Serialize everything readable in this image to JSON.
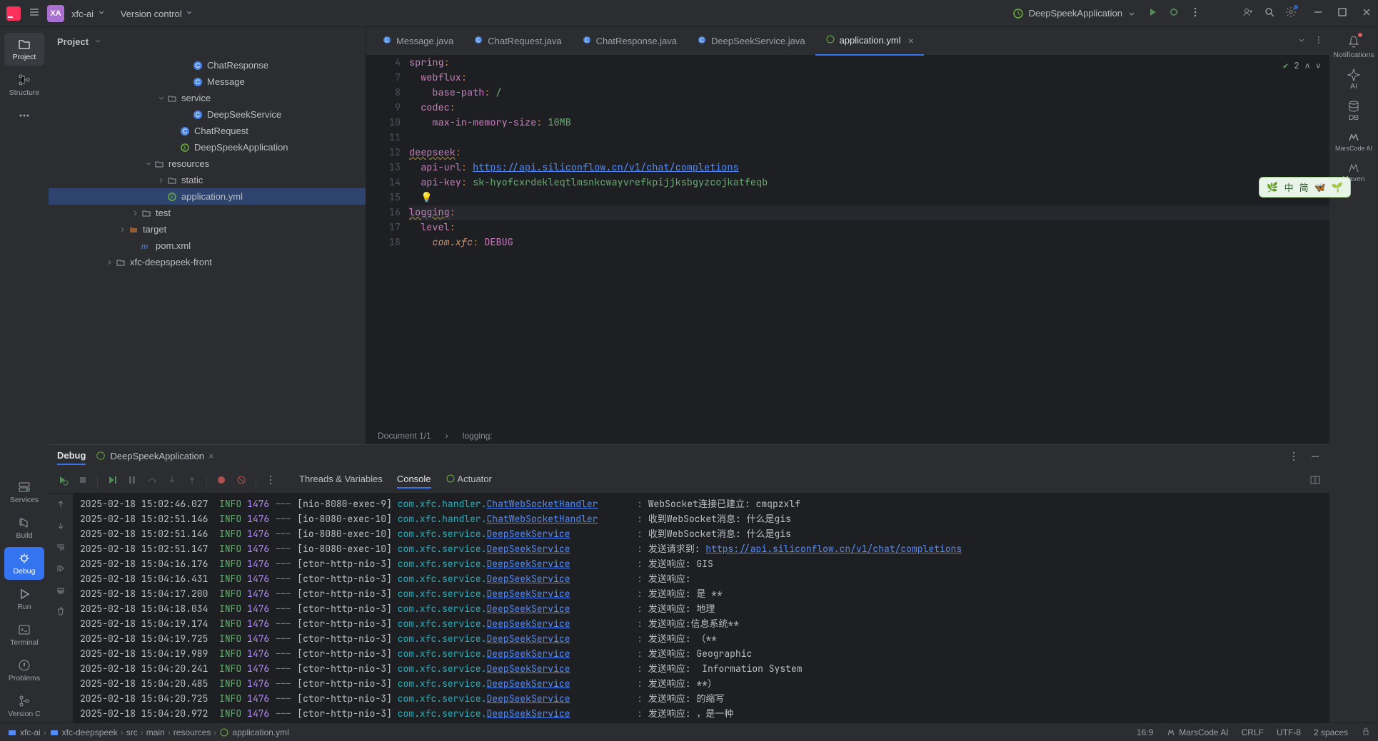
{
  "titlebar": {
    "project_avatar": "XA",
    "project_name": "xfc-ai",
    "version_control": "Version control",
    "run_config": "DeepSpeekApplication"
  },
  "left_tools": [
    {
      "id": "project",
      "label": "Project"
    },
    {
      "id": "structure",
      "label": "Structure"
    },
    {
      "id": "more",
      "label": "..."
    },
    {
      "id": "services",
      "label": "Services"
    },
    {
      "id": "build",
      "label": "Build"
    },
    {
      "id": "debug",
      "label": "Debug"
    },
    {
      "id": "run",
      "label": "Run"
    },
    {
      "id": "terminal",
      "label": "Terminal"
    },
    {
      "id": "problems",
      "label": "Problems"
    },
    {
      "id": "versionc",
      "label": "Version C"
    }
  ],
  "project_header": "Project",
  "tree": [
    {
      "indent": 7,
      "type": "class",
      "label": "ChatResponse"
    },
    {
      "indent": 7,
      "type": "class",
      "label": "Message"
    },
    {
      "indent": 5,
      "type": "pkg",
      "label": "service",
      "expanded": true
    },
    {
      "indent": 7,
      "type": "class",
      "label": "DeepSeekService"
    },
    {
      "indent": 6,
      "type": "class",
      "label": "ChatRequest"
    },
    {
      "indent": 6,
      "type": "spring",
      "label": "DeepSpeekApplication"
    },
    {
      "indent": 4,
      "type": "folder",
      "label": "resources",
      "expanded": true
    },
    {
      "indent": 5,
      "type": "folder",
      "label": "static",
      "collapsed": true
    },
    {
      "indent": 5,
      "type": "spring",
      "label": "application.yml",
      "selected": true
    },
    {
      "indent": 3,
      "type": "folder",
      "label": "test",
      "collapsed": true
    },
    {
      "indent": 2,
      "type": "target",
      "label": "target",
      "collapsed": true
    },
    {
      "indent": 3,
      "type": "maven",
      "label": "pom.xml"
    },
    {
      "indent": 1,
      "type": "folder",
      "label": "xfc-deepspeek-front",
      "collapsed": true
    }
  ],
  "editor_tabs": [
    {
      "label": "Message.java",
      "icon": "class"
    },
    {
      "label": "ChatRequest.java",
      "icon": "class"
    },
    {
      "label": "ChatResponse.java",
      "icon": "class"
    },
    {
      "label": "DeepSeekService.java",
      "icon": "class"
    },
    {
      "label": "application.yml",
      "icon": "spring",
      "active": true,
      "closable": true
    }
  ],
  "inspection": {
    "warnings": "2"
  },
  "code": [
    {
      "n": 4,
      "t": "spring",
      "rest": ":"
    },
    {
      "n": 7,
      "t": "  webflux",
      "rest": ":"
    },
    {
      "n": 8,
      "t": "    base-path",
      "rest": ": ",
      "val": "/"
    },
    {
      "n": 9,
      "t": "  codec",
      "rest": ":"
    },
    {
      "n": 10,
      "t": "    max-in-memory-size",
      "rest": ": ",
      "val": "10MB"
    },
    {
      "n": 11,
      "blank": true
    },
    {
      "n": 12,
      "under": true,
      "t": "deepseek",
      "rest": ":"
    },
    {
      "n": 13,
      "t": "  api-url",
      "rest": ": ",
      "url": "https://api.siliconflow.cn/v1/chat/completions"
    },
    {
      "n": 14,
      "t": "  api-key",
      "rest": ": ",
      "val": "sk-hyofcxrdekleqtlmsnkcwayvrefkpijjksbgyzcojkatfeqb"
    },
    {
      "n": 15,
      "blank": true,
      "bulb": true
    },
    {
      "n": 16,
      "hl": true,
      "under": true,
      "t": "logging",
      "rest": ":"
    },
    {
      "n": 17,
      "t": "  level",
      "rest": ":"
    },
    {
      "n": 18,
      "t": "    ",
      "ident": "com.xfc",
      "rest2": ": ",
      "kw": "DEBUG"
    }
  ],
  "editor_status": {
    "doc": "Document 1/1",
    "path": "logging:"
  },
  "debug": {
    "tab_label": "Debug",
    "config": "DeepSpeekApplication",
    "tabs": [
      "Threads & Variables",
      "Console",
      "Actuator"
    ],
    "active_tab": 1
  },
  "log_lines": [
    {
      "ts": "2025-02-18 15:02:46.027",
      "lv": "INFO",
      "pid": "1476",
      "th": "[nio-8080-exec-9]",
      "pkg": "com.xfc.handler.",
      "cls": "ChatWebSocketHandler",
      "msg": "WebSocket连接已建立: cmqpzxlf"
    },
    {
      "ts": "2025-02-18 15:02:51.146",
      "lv": "INFO",
      "pid": "1476",
      "th": "[io-8080-exec-10]",
      "pkg": "com.xfc.handler.",
      "cls": "ChatWebSocketHandler",
      "msg": "收到WebSocket消息: 什么是gis"
    },
    {
      "ts": "2025-02-18 15:02:51.146",
      "lv": "INFO",
      "pid": "1476",
      "th": "[io-8080-exec-10]",
      "pkg": "com.xfc.service.",
      "cls": "DeepSeekService",
      "msg": "收到WebSocket消息: 什么是gis"
    },
    {
      "ts": "2025-02-18 15:02:51.147",
      "lv": "INFO",
      "pid": "1476",
      "th": "[io-8080-exec-10]",
      "pkg": "com.xfc.service.",
      "cls": "DeepSeekService",
      "msg": "发送请求到: ",
      "url": "https://api.siliconflow.cn/v1/chat/completions"
    },
    {
      "ts": "2025-02-18 15:04:16.176",
      "lv": "INFO",
      "pid": "1476",
      "th": "[ctor-http-nio-3]",
      "pkg": "com.xfc.service.",
      "cls": "DeepSeekService",
      "msg": "发送响应: GIS"
    },
    {
      "ts": "2025-02-18 15:04:16.431",
      "lv": "INFO",
      "pid": "1476",
      "th": "[ctor-http-nio-3]",
      "pkg": "com.xfc.service.",
      "cls": "DeepSeekService",
      "msg": "发送响应:"
    },
    {
      "ts": "2025-02-18 15:04:17.200",
      "lv": "INFO",
      "pid": "1476",
      "th": "[ctor-http-nio-3]",
      "pkg": "com.xfc.service.",
      "cls": "DeepSeekService",
      "msg": "发送响应: 是 **"
    },
    {
      "ts": "2025-02-18 15:04:18.034",
      "lv": "INFO",
      "pid": "1476",
      "th": "[ctor-http-nio-3]",
      "pkg": "com.xfc.service.",
      "cls": "DeepSeekService",
      "msg": "发送响应: 地理"
    },
    {
      "ts": "2025-02-18 15:04:19.174",
      "lv": "INFO",
      "pid": "1476",
      "th": "[ctor-http-nio-3]",
      "pkg": "com.xfc.service.",
      "cls": "DeepSeekService",
      "msg": "发送响应:信息系统**"
    },
    {
      "ts": "2025-02-18 15:04:19.725",
      "lv": "INFO",
      "pid": "1476",
      "th": "[ctor-http-nio-3]",
      "pkg": "com.xfc.service.",
      "cls": "DeepSeekService",
      "msg": "发送响应: （**"
    },
    {
      "ts": "2025-02-18 15:04:19.989",
      "lv": "INFO",
      "pid": "1476",
      "th": "[ctor-http-nio-3]",
      "pkg": "com.xfc.service.",
      "cls": "DeepSeekService",
      "msg": "发送响应: Geographic"
    },
    {
      "ts": "2025-02-18 15:04:20.241",
      "lv": "INFO",
      "pid": "1476",
      "th": "[ctor-http-nio-3]",
      "pkg": "com.xfc.service.",
      "cls": "DeepSeekService",
      "msg": "发送响应:  Information System"
    },
    {
      "ts": "2025-02-18 15:04:20.485",
      "lv": "INFO",
      "pid": "1476",
      "th": "[ctor-http-nio-3]",
      "pkg": "com.xfc.service.",
      "cls": "DeepSeekService",
      "msg": "发送响应: **）"
    },
    {
      "ts": "2025-02-18 15:04:20.725",
      "lv": "INFO",
      "pid": "1476",
      "th": "[ctor-http-nio-3]",
      "pkg": "com.xfc.service.",
      "cls": "DeepSeekService",
      "msg": "发送响应: 的缩写"
    },
    {
      "ts": "2025-02-18 15:04:20.972",
      "lv": "INFO",
      "pid": "1476",
      "th": "[ctor-http-nio-3]",
      "pkg": "com.xfc.service.",
      "cls": "DeepSeekService",
      "msg": "发送响应: ，是一种"
    }
  ],
  "right_tools": [
    {
      "id": "notifications",
      "label": "Notifications",
      "dot": true
    },
    {
      "id": "ai",
      "label": "AI"
    },
    {
      "id": "db",
      "label": "DB"
    },
    {
      "id": "marscode",
      "label": "MarsCode AI"
    },
    {
      "id": "maven",
      "label": "Maven"
    }
  ],
  "breadcrumb": [
    {
      "icon": "folder",
      "label": "xfc-ai"
    },
    {
      "icon": "folder",
      "label": "xfc-deepspeek"
    },
    {
      "label": "src"
    },
    {
      "label": "main"
    },
    {
      "label": "resources"
    },
    {
      "icon": "spring",
      "label": "application.yml"
    }
  ],
  "statusbar": {
    "ratio": "16:9",
    "marscode": "MarsCode AI",
    "crlf": "CRLF",
    "enc": "UTF-8",
    "indent": "2 spaces"
  },
  "ime": {
    "lang": "中",
    "mode": "简"
  }
}
